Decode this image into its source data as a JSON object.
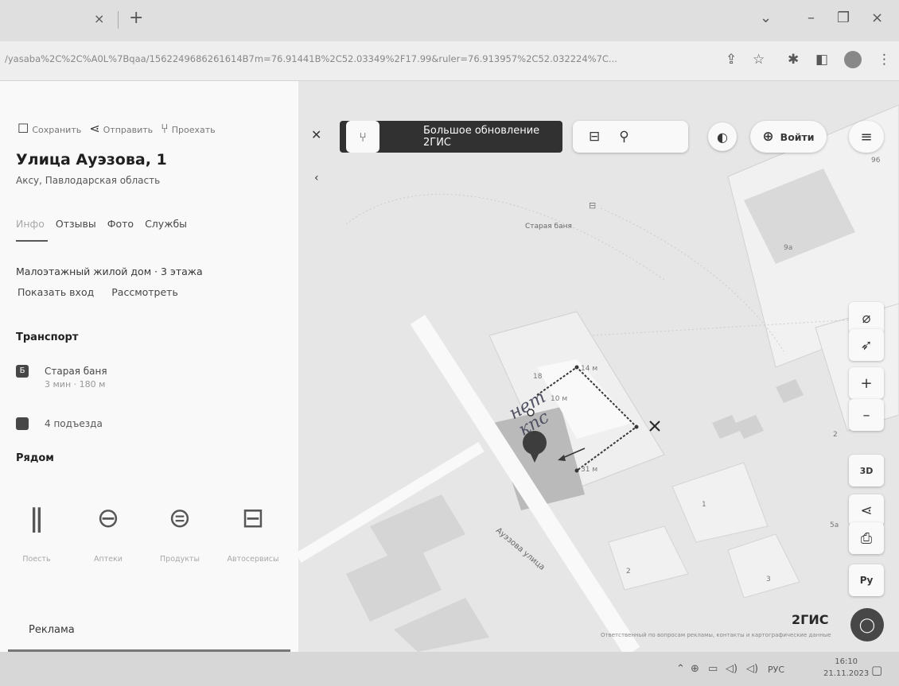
{
  "browser": {
    "tab_close": "×",
    "new_tab": "+",
    "url": "/yasaba%2C%2C%A0L%7Bqaa/1562249686261614B7m=76.91441B%2C52.03349%2F17.99&ruler=76.913957%2C52.032224%7C...",
    "window": {
      "chevron": "⌄",
      "minimize": "–",
      "restore": "❐",
      "close": "×"
    },
    "icons": [
      "share-icon",
      "star-icon",
      "extensions-icon",
      "sidebar-icon",
      "profile-icon",
      "menu-icon"
    ]
  },
  "sidebar": {
    "actions": [
      {
        "icon": "bookmark-icon",
        "glyph": "⌑",
        "label": "Сохранить"
      },
      {
        "icon": "share-icon",
        "glyph": "⋖",
        "label": "Отправить"
      },
      {
        "icon": "route-icon",
        "glyph": "⑂",
        "label": "Проехать"
      }
    ],
    "title": "Улица Ауэзова, 1",
    "subtitle": "Аксу, Павлодарская область",
    "tabs": [
      "Инфо",
      "Отзывы",
      "Фото",
      "Службы"
    ],
    "building": "Малоэтажный жилой дом · 3 этажа",
    "links": [
      "Показать вход",
      "Рассмотреть"
    ],
    "transport_heading": "Транспорт",
    "stop": {
      "icon_letter": "Б",
      "name": "Старая баня",
      "distance": "3 мин · 180 м"
    },
    "entrances": "4 подъезда",
    "nearby_heading": "Рядом",
    "nearby": [
      {
        "icon": "restaurant-icon",
        "glyph": "🍴",
        "label": "Поесть"
      },
      {
        "icon": "pharmacy-icon",
        "glyph": "💊",
        "label": "Аптеки"
      },
      {
        "icon": "groceries-icon",
        "glyph": "🧺",
        "label": "Продукты"
      },
      {
        "icon": "car-service-icon",
        "glyph": "🚗",
        "label": "Автосервисы"
      }
    ],
    "ad_label": "Реклама"
  },
  "map": {
    "banner_text": "Большое обновление 2ГИС",
    "pin_label": "Старая баня",
    "pin_label_small": "Старая баня",
    "street": "Ауэзова улица",
    "handwriting": [
      "нет",
      "кпс"
    ],
    "ruler_labels": [
      "18",
      "14 м",
      "10 м",
      "31 м"
    ],
    "building_numbers": [
      "9a",
      "1",
      "2",
      "3",
      "5a",
      "2",
      "96"
    ],
    "login_label": "Войти",
    "zoom_in": "+",
    "zoom_out": "–",
    "mode_3d": "3D",
    "lang": "Ру",
    "brand": "2ГИС",
    "copyright": "Ответственный по вопросам рекламы, контакты и картографические данные"
  },
  "taskbar": {
    "lang": "РУС",
    "time": "16:10",
    "date": "21.11.2023"
  }
}
